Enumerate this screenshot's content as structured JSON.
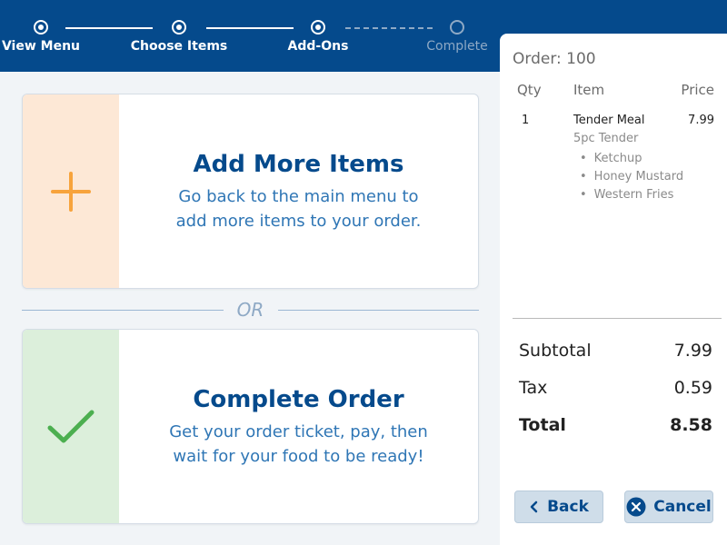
{
  "progress": {
    "steps": [
      {
        "label": "View Menu",
        "state": "done"
      },
      {
        "label": "Choose Items",
        "state": "done"
      },
      {
        "label": "Add-Ons",
        "state": "current"
      },
      {
        "label": "Complete",
        "state": "pending"
      }
    ]
  },
  "main": {
    "add_more": {
      "title": "Add More Items",
      "desc_line1": "Go back to the main menu to",
      "desc_line2": "add more items to your order.",
      "icon": "plus-icon"
    },
    "or_text": "OR",
    "complete": {
      "title": "Complete Order",
      "desc_line1": "Get your order ticket, pay, then",
      "desc_line2": "wait for your food to be ready!",
      "icon": "check-icon"
    }
  },
  "order": {
    "title": "Order: 100",
    "columns": {
      "qty": "Qty",
      "item": "Item",
      "price": "Price"
    },
    "items": [
      {
        "qty": "1",
        "name": "Tender Meal",
        "price": "7.99",
        "variant": "5pc Tender",
        "modifiers": [
          "Ketchup",
          "Honey Mustard",
          "Western Fries"
        ]
      }
    ],
    "subtotal_label": "Subtotal",
    "subtotal": "7.99",
    "tax_label": "Tax",
    "tax": "0.59",
    "total_label": "Total",
    "total": "8.58",
    "back_label": "Back",
    "cancel_label": "Cancel"
  },
  "colors": {
    "header_blue": "#054a8c",
    "title_blue": "#054a8c",
    "desc_blue": "#2f76b5",
    "add_panel": "#fde8d6",
    "complete_panel": "#dcefdb",
    "plus_orange": "#f7a33c",
    "check_green": "#4caf50"
  }
}
